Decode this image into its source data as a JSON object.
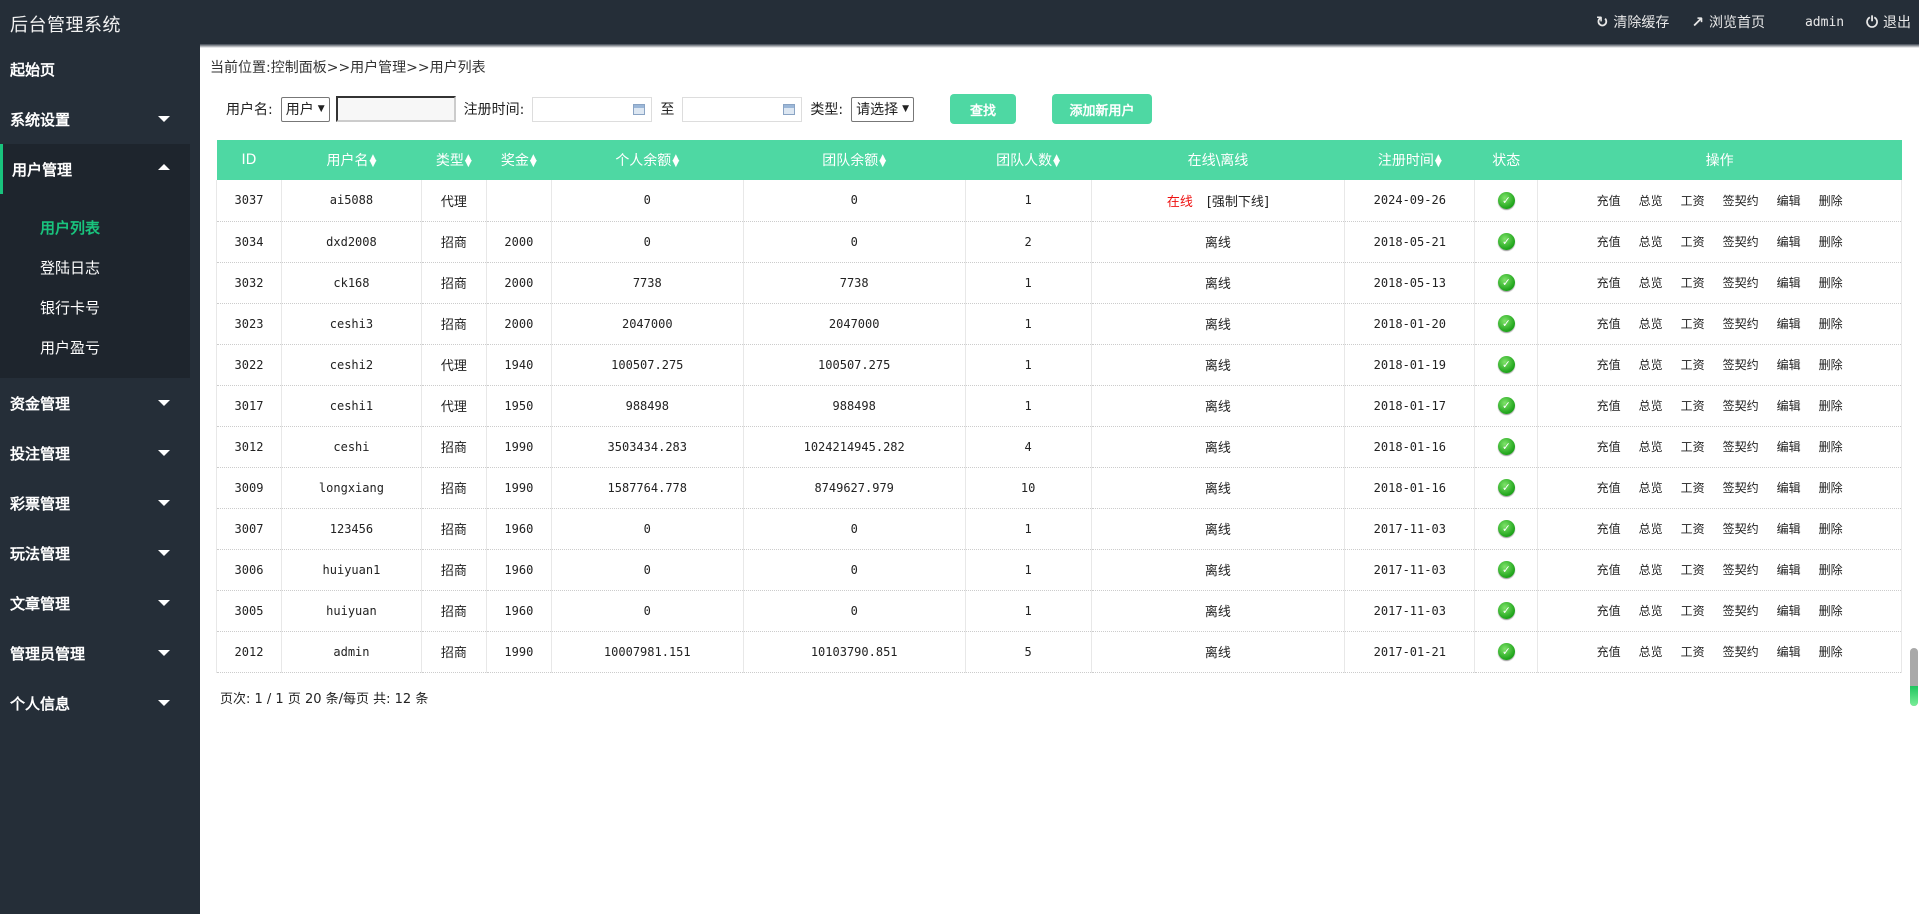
{
  "app": {
    "title": "后台管理系统"
  },
  "topbar": {
    "clear_cache": "清除缓存",
    "browse_home": "浏览首页",
    "user": "admin",
    "logout": "退出"
  },
  "sidebar": {
    "items": [
      {
        "label": "起始页",
        "has_caret": false,
        "open": false
      },
      {
        "label": "系统设置",
        "has_caret": true,
        "open": false
      },
      {
        "label": "用户管理",
        "has_caret": true,
        "open": true
      },
      {
        "label": "资金管理",
        "has_caret": true,
        "open": false
      },
      {
        "label": "投注管理",
        "has_caret": true,
        "open": false
      },
      {
        "label": "彩票管理",
        "has_caret": true,
        "open": false
      },
      {
        "label": "玩法管理",
        "has_caret": true,
        "open": false
      },
      {
        "label": "文章管理",
        "has_caret": true,
        "open": false
      },
      {
        "label": "管理员管理",
        "has_caret": true,
        "open": false
      },
      {
        "label": "个人信息",
        "has_caret": true,
        "open": false
      }
    ],
    "sub_items": [
      {
        "label": "用户列表",
        "active": true
      },
      {
        "label": "登陆日志",
        "active": false
      },
      {
        "label": "银行卡号",
        "active": false
      },
      {
        "label": "用户盈亏",
        "active": false
      }
    ]
  },
  "breadcrumb": {
    "prefix": "当前位置:",
    "path": "控制面板>>用户管理>>用户列表"
  },
  "filter": {
    "username_label": "用户名:",
    "username_type": "用户",
    "username_value": "",
    "reg_time_label": "注册时间:",
    "date_from": "",
    "to_label": "至",
    "date_to": "",
    "type_label": "类型:",
    "type_value": "请选择",
    "search_button": "查找",
    "add_button": "添加新用户"
  },
  "table": {
    "columns": [
      "ID",
      "用户名",
      "类型",
      "奖金",
      "个人余额",
      "团队余额",
      "团队人数",
      "在线\\离线",
      "注册时间",
      "状态",
      "操作"
    ],
    "sortable": [
      false,
      true,
      true,
      true,
      true,
      true,
      true,
      false,
      true,
      false,
      false
    ],
    "actions": [
      "充值",
      "总览",
      "工资",
      "签契约",
      "编辑",
      "删除"
    ],
    "online_label": "在线",
    "force_offline_label": "[强制下线]",
    "offline_label": "离线",
    "rows": [
      {
        "id": "3037",
        "username": "ai5088",
        "type": "代理",
        "bonus": "",
        "personal": "0",
        "team": "0",
        "team_count": "1",
        "online": true,
        "reg": "2024-09-26",
        "status": "ok"
      },
      {
        "id": "3034",
        "username": "dxd2008",
        "type": "招商",
        "bonus": "2000",
        "personal": "0",
        "team": "0",
        "team_count": "2",
        "online": false,
        "reg": "2018-05-21",
        "status": "ok"
      },
      {
        "id": "3032",
        "username": "ck168",
        "type": "招商",
        "bonus": "2000",
        "personal": "7738",
        "team": "7738",
        "team_count": "1",
        "online": false,
        "reg": "2018-05-13",
        "status": "ok"
      },
      {
        "id": "3023",
        "username": "ceshi3",
        "type": "招商",
        "bonus": "2000",
        "personal": "2047000",
        "team": "2047000",
        "team_count": "1",
        "online": false,
        "reg": "2018-01-20",
        "status": "ok"
      },
      {
        "id": "3022",
        "username": "ceshi2",
        "type": "代理",
        "bonus": "1940",
        "personal": "100507.275",
        "team": "100507.275",
        "team_count": "1",
        "online": false,
        "reg": "2018-01-19",
        "status": "ok"
      },
      {
        "id": "3017",
        "username": "ceshi1",
        "type": "代理",
        "bonus": "1950",
        "personal": "988498",
        "team": "988498",
        "team_count": "1",
        "online": false,
        "reg": "2018-01-17",
        "status": "ok"
      },
      {
        "id": "3012",
        "username": "ceshi",
        "type": "招商",
        "bonus": "1990",
        "personal": "3503434.283",
        "team": "1024214945.282",
        "team_count": "4",
        "online": false,
        "reg": "2018-01-16",
        "status": "ok"
      },
      {
        "id": "3009",
        "username": "longxiang",
        "type": "招商",
        "bonus": "1990",
        "personal": "1587764.778",
        "team": "8749627.979",
        "team_count": "10",
        "online": false,
        "reg": "2018-01-16",
        "status": "ok"
      },
      {
        "id": "3007",
        "username": "123456",
        "type": "招商",
        "bonus": "1960",
        "personal": "0",
        "team": "0",
        "team_count": "1",
        "online": false,
        "reg": "2017-11-03",
        "status": "ok"
      },
      {
        "id": "3006",
        "username": "huiyuan1",
        "type": "招商",
        "bonus": "1960",
        "personal": "0",
        "team": "0",
        "team_count": "1",
        "online": false,
        "reg": "2017-11-03",
        "status": "ok"
      },
      {
        "id": "3005",
        "username": "huiyuan",
        "type": "招商",
        "bonus": "1960",
        "personal": "0",
        "team": "0",
        "team_count": "1",
        "online": false,
        "reg": "2017-11-03",
        "status": "ok"
      },
      {
        "id": "2012",
        "username": "admin",
        "type": "招商",
        "bonus": "1990",
        "personal": "10007981.151",
        "team": "10103790.851",
        "team_count": "5",
        "online": false,
        "reg": "2017-01-21",
        "status": "ok"
      }
    ]
  },
  "pager": {
    "text": "页次: 1 / 1 页 20 条/每页 共: 12 条"
  },
  "colors": {
    "accent": "#4ed8a3",
    "sidebar_bg": "#252e38",
    "active_green": "#19c37d",
    "online_red": "#ee1111"
  }
}
